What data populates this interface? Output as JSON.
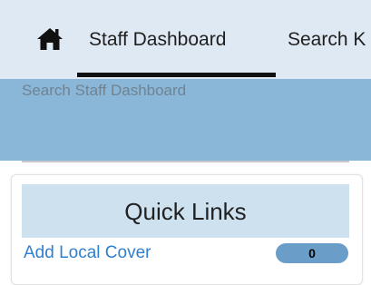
{
  "nav": {
    "home_icon": "home-icon",
    "tabs": [
      {
        "label": "Staff Dashboard",
        "active": true
      },
      {
        "label": "Search K"
      }
    ]
  },
  "search": {
    "placeholder": "Search Staff Dashboard",
    "value": ""
  },
  "quick_links": {
    "title": "Quick Links",
    "items": [
      {
        "label": "Add Local Cover",
        "count": "0"
      }
    ]
  },
  "colors": {
    "nav_background": "#dfe9f3",
    "search_band": "#8ab6d8",
    "card_header": "#cde1ef",
    "link": "#2f80d0",
    "badge": "#6a9ec9"
  }
}
